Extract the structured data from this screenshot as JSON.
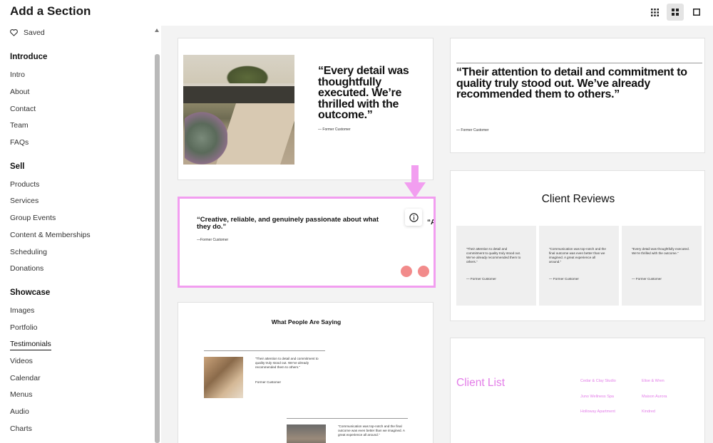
{
  "header": {
    "title": "Add a Section",
    "view_icons": [
      "grid-small-icon",
      "grid-large-icon",
      "single-view-icon"
    ],
    "active_view": "grid-large-icon"
  },
  "sidebar": {
    "saved_label": "Saved",
    "categories": [
      {
        "title": "Introduce",
        "items": [
          "Intro",
          "About",
          "Contact",
          "Team",
          "FAQs"
        ]
      },
      {
        "title": "Sell",
        "items": [
          "Products",
          "Services",
          "Group Events",
          "Content & Memberships",
          "Scheduling",
          "Donations"
        ]
      },
      {
        "title": "Showcase",
        "items": [
          "Images",
          "Portfolio",
          "Testimonials",
          "Videos",
          "Calendar",
          "Menus",
          "Audio",
          "Charts"
        ]
      }
    ],
    "selected_item": "Testimonials"
  },
  "cards": {
    "card1": {
      "quote": "“Every detail was thoughtfully executed. We’re thrilled with the outcome.”",
      "attribution": "— Former Customer"
    },
    "card2": {
      "quote": "“Their attention to detail and commitment to quality truly stood out. We’ve already recommended them to others.”",
      "attribution": "— Former Customer"
    },
    "card3": {
      "quote": "“Creative, reliable, and genuinely passionate about what they do.”",
      "attribution": "—Former Customer",
      "peek_text": "“A"
    },
    "card4": {
      "title": "Client Reviews",
      "reviews": [
        {
          "quote": "“Their attention to detail and commitment to quality truly stood out. We’ve already recommended them to others.”",
          "attribution": "— Former Customer"
        },
        {
          "quote": "“Communication was top-notch and the final outcome was even better than we imagined. A great experience all around.”",
          "attribution": "— Former Customer"
        },
        {
          "quote": "“Every detail was thoughtfully executed. We’re thrilled with the outcome.”",
          "attribution": "— Former Customer"
        }
      ]
    },
    "card5": {
      "title": "What People Are Saying",
      "quote1": "“Their attention to detail and commitment to quality truly stood out. We’ve already recommended them to others.”",
      "attribution1": "Former Customer",
      "quote2": "“Communication was top-notch and the final outcome was even better than we imagined. A great experience all around.”"
    },
    "card6": {
      "title": "Client List",
      "clients": [
        "Cedar & Clay Studio",
        "Elise & Wren",
        "Juno Wellness Spa",
        "Maison Aurora",
        "Holloway Apartment",
        "Kindred"
      ]
    }
  },
  "colors": {
    "highlight": "#f29ef0",
    "accent_pink": "#e37de8",
    "dot_pink": "#f28b8b"
  }
}
